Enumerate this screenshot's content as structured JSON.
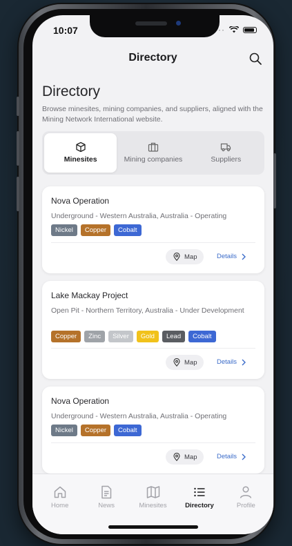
{
  "status": {
    "time": "10:07"
  },
  "nav": {
    "title": "Directory"
  },
  "heading": "Directory",
  "subheading": "Browse minesites, mining companies, and suppliers, aligned with the Mining Network International website.",
  "segments": [
    {
      "label": "Minesites",
      "icon": "cube-icon",
      "active": true
    },
    {
      "label": "Mining companies",
      "icon": "briefcase-icon",
      "active": false
    },
    {
      "label": "Suppliers",
      "icon": "truck-icon",
      "active": false
    }
  ],
  "cards": [
    {
      "title": "Nova Operation",
      "subtitle": "Underground - Western Australia, Australia - Operating",
      "tags": [
        {
          "label": "Nickel",
          "color": "#6e7a88"
        },
        {
          "label": "Copper",
          "color": "#b5722a"
        },
        {
          "label": "Cobalt",
          "color": "#3d68d4"
        }
      ],
      "map_label": "Map",
      "details_label": "Details"
    },
    {
      "title": "Lake Mackay Project",
      "subtitle": "Open Pit - Northern Territory, Australia - Under Development",
      "tags": [
        {
          "label": "Copper",
          "color": "#b5722a"
        },
        {
          "label": "Zinc",
          "color": "#9fa3a8"
        },
        {
          "label": "Silver",
          "color": "#c3c6ca"
        },
        {
          "label": "Gold",
          "color": "#f1c21b"
        },
        {
          "label": "Lead",
          "color": "#5a5d62"
        },
        {
          "label": "Cobalt",
          "color": "#3d68d4"
        }
      ],
      "map_label": "Map",
      "details_label": "Details"
    },
    {
      "title": "Nova Operation",
      "subtitle": "Underground - Western Australia, Australia - Operating",
      "tags": [
        {
          "label": "Nickel",
          "color": "#6e7a88"
        },
        {
          "label": "Copper",
          "color": "#b5722a"
        },
        {
          "label": "Cobalt",
          "color": "#3d68d4"
        }
      ],
      "map_label": "Map",
      "details_label": "Details"
    }
  ],
  "tabs": [
    {
      "label": "Home",
      "icon": "home-icon",
      "active": false
    },
    {
      "label": "News",
      "icon": "news-icon",
      "active": false
    },
    {
      "label": "Minesites",
      "icon": "map-icon",
      "active": false
    },
    {
      "label": "Directory",
      "icon": "list-icon",
      "active": true
    },
    {
      "label": "Profile",
      "icon": "profile-icon",
      "active": false
    }
  ],
  "colors": {
    "accent": "#3a6bc9",
    "background": "#f2f2f4"
  }
}
